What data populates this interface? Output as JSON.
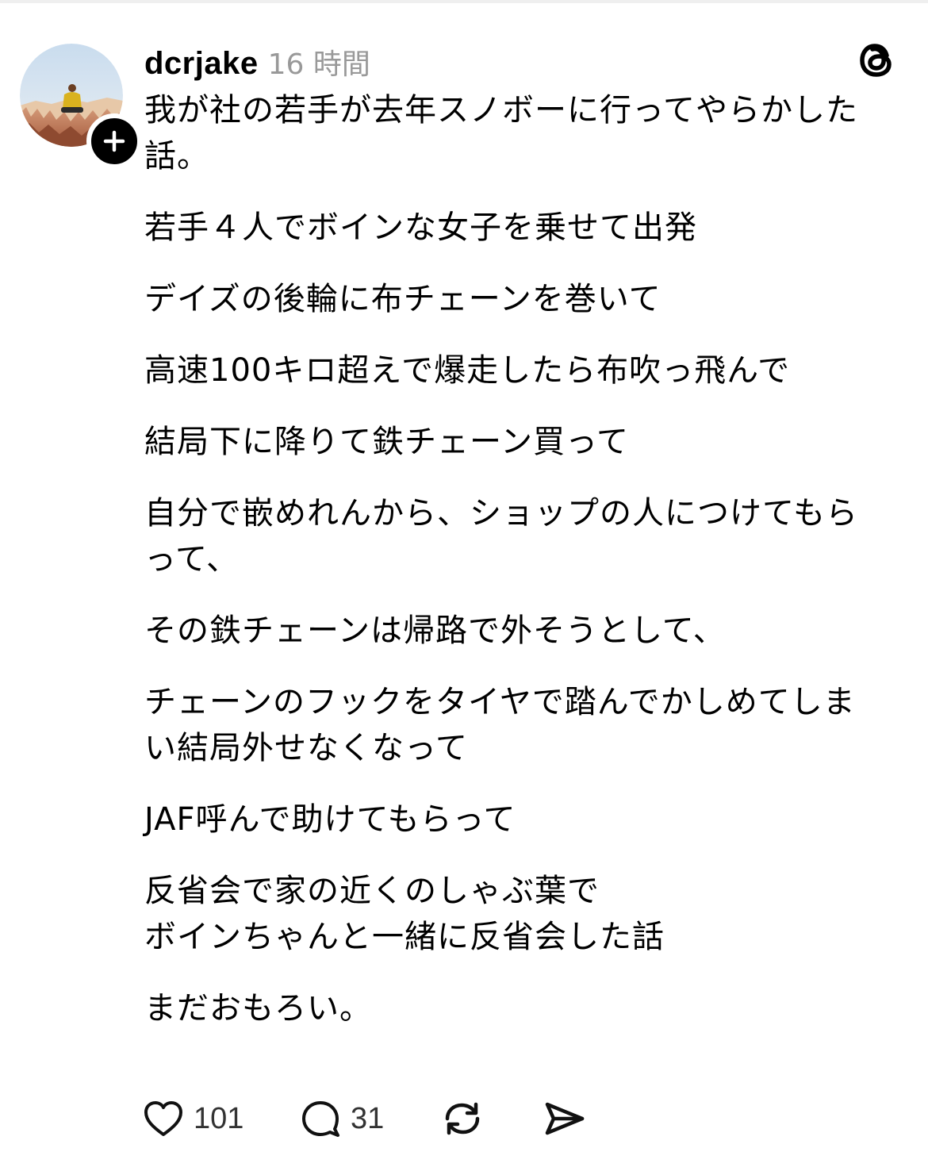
{
  "post": {
    "username": "dcrjake",
    "timestamp": "16 時間",
    "paragraphs": [
      [
        "我が社の若手が去年スノボーに行ってやらかした",
        "話。"
      ],
      [
        "若手４人でボインな女子を乗せて出発"
      ],
      [
        "デイズの後輪に布チェーンを巻いて"
      ],
      [
        "高速100キロ超えで爆走したら布吹っ飛んで"
      ],
      [
        "結局下に降りて鉄チェーン買って"
      ],
      [
        "自分で嵌めれんから、ショップの人につけてもら",
        "って、"
      ],
      [
        "その鉄チェーンは帰路で外そうとして、"
      ],
      [
        "チェーンのフックをタイヤで踏んでかしめてしま",
        "い結局外せなくなって"
      ],
      [
        "JAF呼んで助けてもらって"
      ],
      [
        "反省会で家の近くのしゃぶ葉で",
        "ボインちゃんと一緒に反省会した話"
      ],
      [
        "まだおもろい。"
      ]
    ]
  },
  "actions": {
    "like_count": "101",
    "reply_count": "31"
  },
  "icons": {
    "follow": "plus-icon",
    "brand": "threads-logo-icon",
    "like": "heart-icon",
    "reply": "comment-bubble-icon",
    "repost": "repost-icon",
    "share": "send-icon"
  },
  "colors": {
    "text": "#000000",
    "muted": "#999999",
    "counts": "#333333"
  }
}
